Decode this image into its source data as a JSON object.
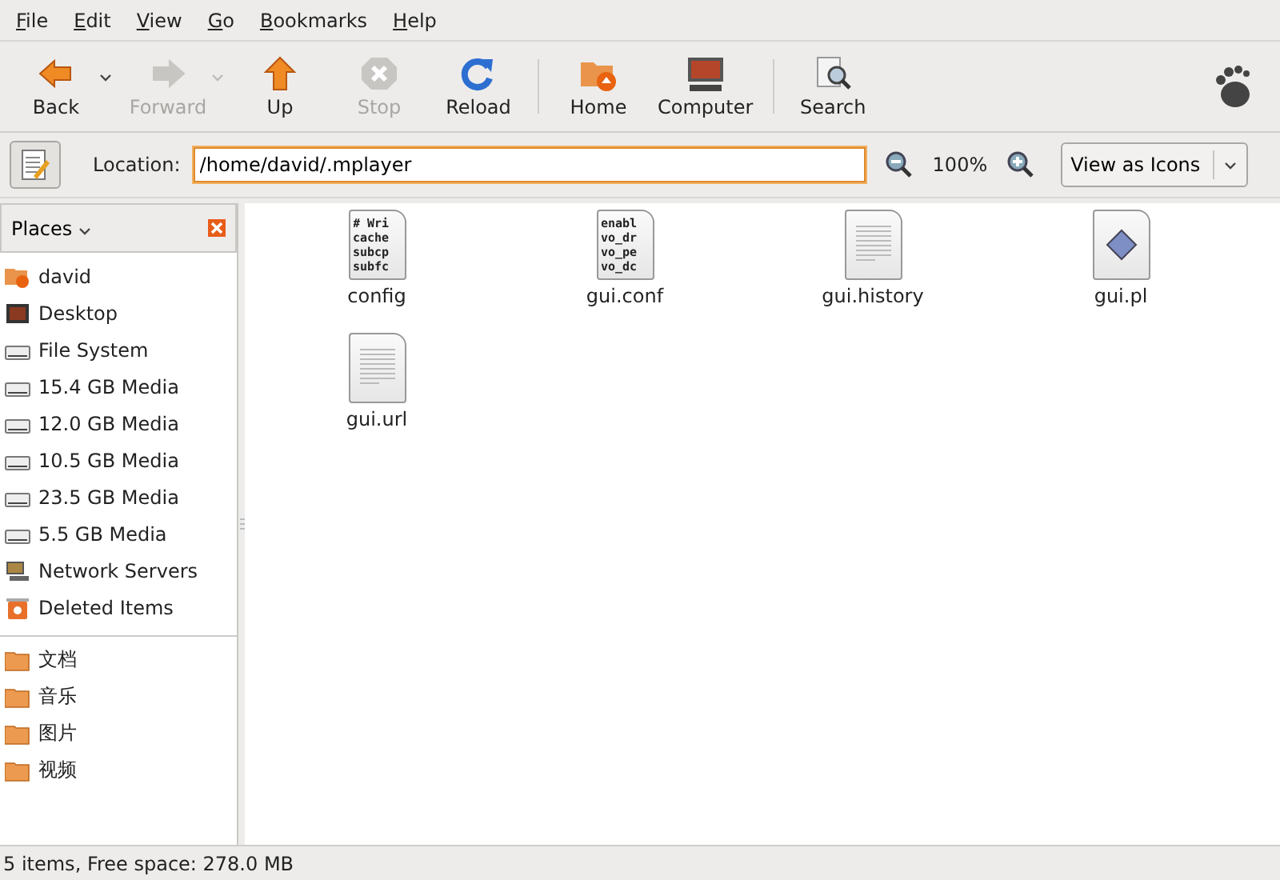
{
  "menu": [
    "File",
    "Edit",
    "View",
    "Go",
    "Bookmarks",
    "Help"
  ],
  "toolbar": [
    {
      "label": "Back",
      "kind": "back",
      "disabled": false,
      "dropdown": true
    },
    {
      "label": "Forward",
      "kind": "forward",
      "disabled": true,
      "dropdown": true
    },
    {
      "label": "Up",
      "kind": "up",
      "disabled": false,
      "dropdown": false
    },
    {
      "label": "Stop",
      "kind": "stop",
      "disabled": true,
      "dropdown": false
    },
    {
      "label": "Reload",
      "kind": "reload",
      "disabled": false,
      "dropdown": false
    },
    {
      "kind": "separator"
    },
    {
      "label": "Home",
      "kind": "home",
      "disabled": false,
      "dropdown": false
    },
    {
      "label": "Computer",
      "kind": "computer",
      "disabled": false,
      "dropdown": false
    },
    {
      "kind": "separator"
    },
    {
      "label": "Search",
      "kind": "search",
      "disabled": false,
      "dropdown": false
    }
  ],
  "location": {
    "label": "Location:",
    "value": "/home/david/.mplayer",
    "zoom": "100%",
    "view_mode": "View as Icons"
  },
  "sidebar": {
    "title": "Places",
    "groups": [
      [
        {
          "label": "david",
          "kind": "home"
        },
        {
          "label": "Desktop",
          "kind": "desktop"
        },
        {
          "label": "File System",
          "kind": "drive"
        },
        {
          "label": "15.4 GB Media",
          "kind": "drive"
        },
        {
          "label": "12.0 GB Media",
          "kind": "drive"
        },
        {
          "label": "10.5 GB Media",
          "kind": "drive"
        },
        {
          "label": "23.5 GB Media",
          "kind": "drive"
        },
        {
          "label": "5.5 GB Media",
          "kind": "drive"
        },
        {
          "label": "Network Servers",
          "kind": "network"
        },
        {
          "label": "Deleted Items",
          "kind": "trash"
        }
      ],
      [
        {
          "label": "文档",
          "kind": "folder"
        },
        {
          "label": "音乐",
          "kind": "folder"
        },
        {
          "label": "图片",
          "kind": "folder"
        },
        {
          "label": "视频",
          "kind": "folder"
        }
      ]
    ]
  },
  "files": [
    {
      "name": "config",
      "kind": "preview",
      "preview": [
        "# Wri",
        "cache",
        "subcp",
        "subfc"
      ]
    },
    {
      "name": "gui.conf",
      "kind": "preview",
      "preview": [
        "enabl",
        "vo_dr",
        "vo_pe",
        "vo_dc"
      ]
    },
    {
      "name": "gui.history",
      "kind": "text"
    },
    {
      "name": "gui.pl",
      "kind": "script"
    },
    {
      "name": "gui.url",
      "kind": "text"
    }
  ],
  "status_bar": "5 items, Free space: 278.0 MB"
}
